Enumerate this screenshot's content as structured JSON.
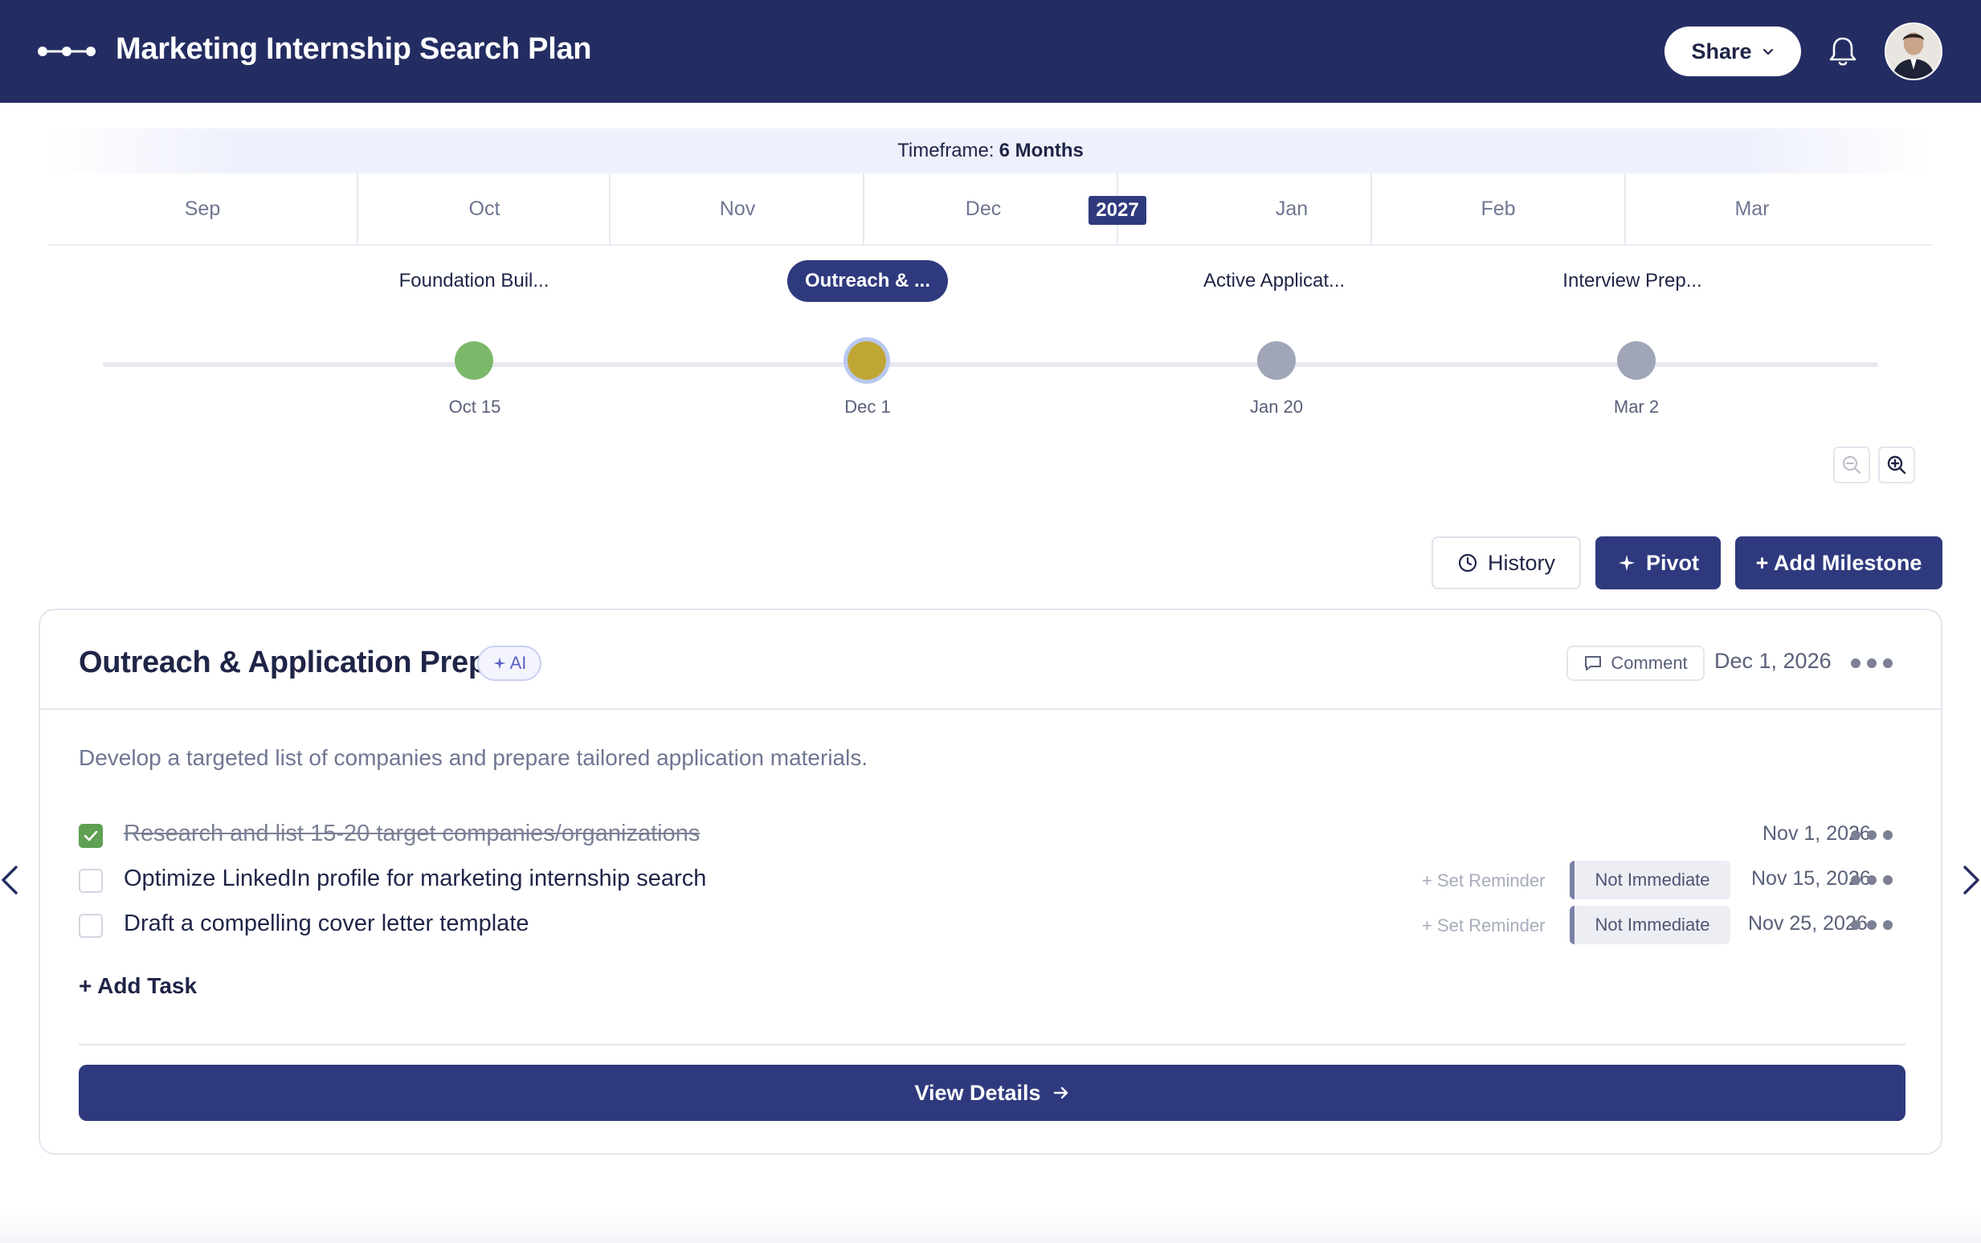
{
  "header": {
    "title": "Marketing Internship Search Plan",
    "share_label": "Share"
  },
  "timeline": {
    "timeframe_label": "Timeframe:",
    "timeframe_value": "6 Months",
    "months": [
      "Sep",
      "Oct",
      "Nov",
      "Dec",
      "Jan",
      "Feb",
      "Mar"
    ],
    "year_badge": "2027",
    "milestones": [
      {
        "label": "Foundation Buil...",
        "date": "Oct 15",
        "color": "#7cb86a",
        "active": false
      },
      {
        "label": "Outreach & ...",
        "date": "Dec 1",
        "color": "#c0a635",
        "active": true
      },
      {
        "label": "Active Applicat...",
        "date": "Jan 20",
        "color": "#a0a6b8",
        "active": false
      },
      {
        "label": "Interview Prep...",
        "date": "Mar 2",
        "color": "#a0a6b8",
        "active": false
      }
    ]
  },
  "actions": {
    "history_label": "History",
    "pivot_label": "Pivot",
    "add_milestone_label": "+ Add Milestone"
  },
  "card": {
    "title": "Outreach & Application Prep",
    "ai_badge": "AI",
    "comment_label": "Comment",
    "date": "Dec 1, 2026",
    "description": "Develop a targeted list of companies and prepare tailored application materials.",
    "tasks": [
      {
        "text": "Research and list 15-20 target companies/organizations",
        "done": true,
        "reminder": "",
        "priority": "",
        "date": "Nov 1, 2026"
      },
      {
        "text": "Optimize LinkedIn profile for marketing internship search",
        "done": false,
        "reminder": "+ Set Reminder",
        "priority": "Not Immediate",
        "date": "Nov 15, 2026"
      },
      {
        "text": "Draft a compelling cover letter template",
        "done": false,
        "reminder": "+ Set Reminder",
        "priority": "Not Immediate",
        "date": "Nov 25, 2026"
      }
    ],
    "add_task_label": "+ Add Task",
    "view_details_label": "View Details"
  },
  "colors": {
    "header_bg": "#242d62",
    "accent": "#2f3a7e",
    "done_check": "#5fa053"
  }
}
